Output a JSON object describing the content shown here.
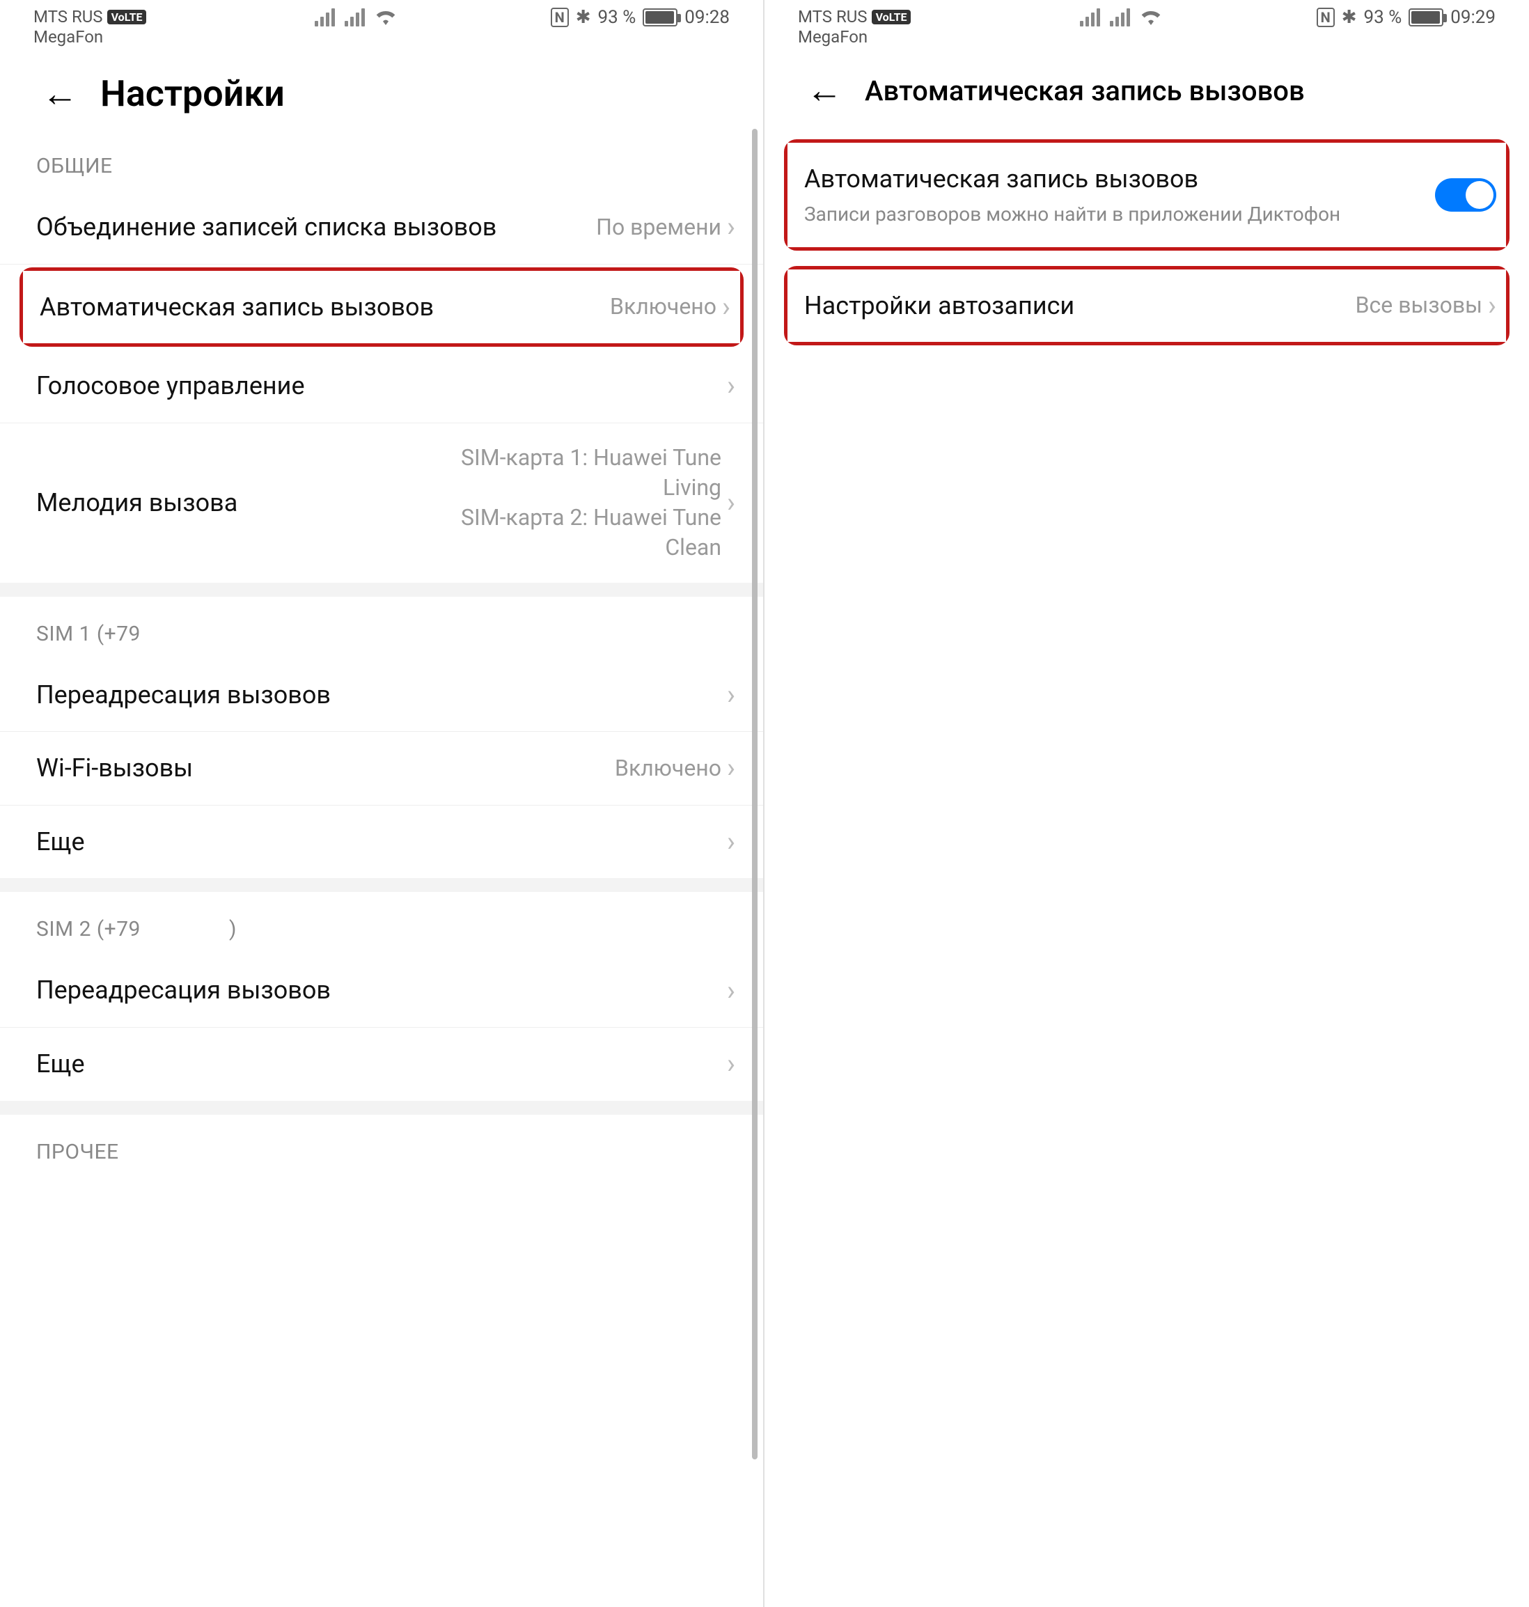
{
  "left": {
    "status": {
      "carrier1": "MTS RUS",
      "badge": "VoLTE",
      "carrier2": "MegaFon",
      "nfc": "N",
      "bt": "✱",
      "battery_pct": "93 %",
      "time": "09:28"
    },
    "header": {
      "title": "Настройки"
    },
    "sections": {
      "general_label": "ОБЩИЕ",
      "merge": {
        "title": "Объединение записей списка вызовов",
        "value": "По времени"
      },
      "autorecord": {
        "title": "Автоматическая запись вызовов",
        "value": "Включено"
      },
      "voice_control": {
        "title": "Голосовое управление"
      },
      "ringtone": {
        "title": "Мелодия вызова",
        "value_line1": "SIM-карта 1: Huawei Tune Living",
        "value_line2": "SIM-карта 2: Huawei Tune Clean"
      },
      "sim1_label": "SIM 1 (+79",
      "sim1_forward": {
        "title": "Переадресация вызовов"
      },
      "sim1_wifi": {
        "title": "Wi-Fi-вызовы",
        "value": "Включено"
      },
      "sim1_more": {
        "title": "Еще"
      },
      "sim2_label_pre": "SIM 2 (+79",
      "sim2_label_post": ")",
      "sim2_forward": {
        "title": "Переадресация вызовов"
      },
      "sim2_more": {
        "title": "Еще"
      },
      "other_label": "ПРОЧЕЕ"
    }
  },
  "right": {
    "status": {
      "carrier1": "MTS RUS",
      "badge": "VoLTE",
      "carrier2": "MegaFon",
      "nfc": "N",
      "bt": "✱",
      "battery_pct": "93 %",
      "time": "09:29"
    },
    "header": {
      "title": "Автоматическая запись вызовов"
    },
    "card1": {
      "title": "Автоматическая запись вызовов",
      "sub": "Записи разговоров можно найти в приложении Диктофон"
    },
    "card2": {
      "title": "Настройки автозаписи",
      "value": "Все вызовы"
    }
  }
}
